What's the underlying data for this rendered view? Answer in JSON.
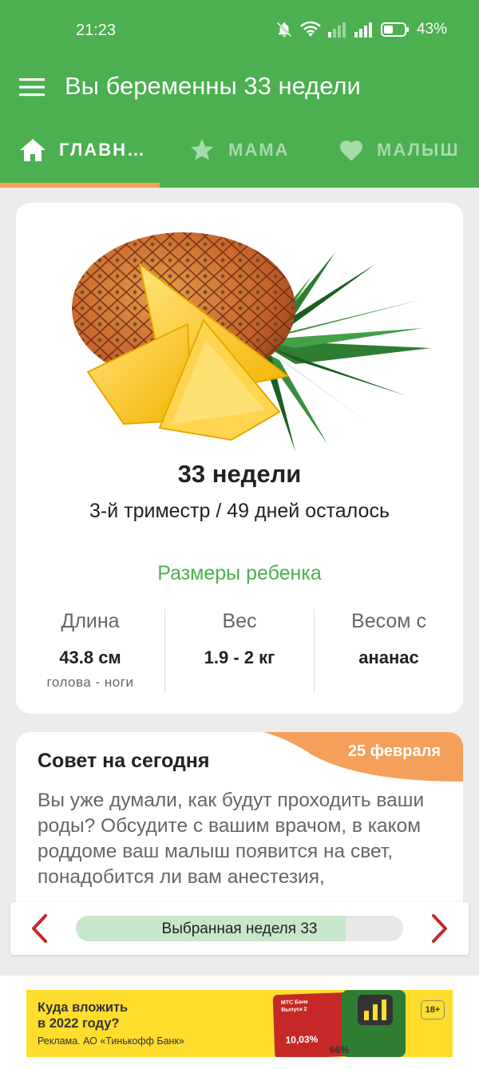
{
  "status": {
    "time": "21:23",
    "battery": "43%",
    "icons": [
      "mute-bell-icon",
      "wifi-icon",
      "signal-icon",
      "signal-icon",
      "battery-icon"
    ]
  },
  "colors": {
    "primary": "#4caf50",
    "accent": "#f5a05a",
    "arrow": "#c62828"
  },
  "app_bar": {
    "title": "Вы беременны 33 недели",
    "menu_icon": "hamburger-menu-icon"
  },
  "tabs": [
    {
      "label": "ГЛАВН…",
      "icon": "home-icon",
      "selected": true
    },
    {
      "label": "МАМА",
      "icon": "star-icon",
      "selected": false
    },
    {
      "label": "МАЛЫШ",
      "icon": "heart-icon",
      "selected": false
    }
  ],
  "week_card": {
    "fruit_image": "pineapple",
    "title": "33 недели",
    "subtitle": "3-й триместр / 49 дней осталось",
    "sizes_title": "Размеры ребенка",
    "metrics": [
      {
        "label": "Длина",
        "value": "43.8 см",
        "note": "голова - ноги"
      },
      {
        "label": "Вес",
        "value": "1.9 - 2 кг",
        "note": ""
      },
      {
        "label": "Весом с",
        "value": "ананас",
        "note": ""
      }
    ]
  },
  "tip_card": {
    "title": "Совет на сегодня",
    "date": "25 февраля",
    "text": "Вы уже думали, как будут проходить ваши роды? Обсудите с вашим врачом, в каком роддоме ваш малыш появится на свет, понадобится ли вам анестезия,"
  },
  "week_selector": {
    "label": "Выбранная неделя 33",
    "progress_fraction": 0.825,
    "prev_icon": "chevron-left-icon",
    "next_icon": "chevron-right-icon"
  },
  "ad": {
    "headline_line1": "Куда вложить",
    "headline_line2": "в 2022 году?",
    "disclaimer": "Реклама. АО «Тинькофф Банк»",
    "card_text": "МТС Банк Выпуск 2",
    "rate": "10,03%",
    "rate2": "66%",
    "age": "18+"
  }
}
